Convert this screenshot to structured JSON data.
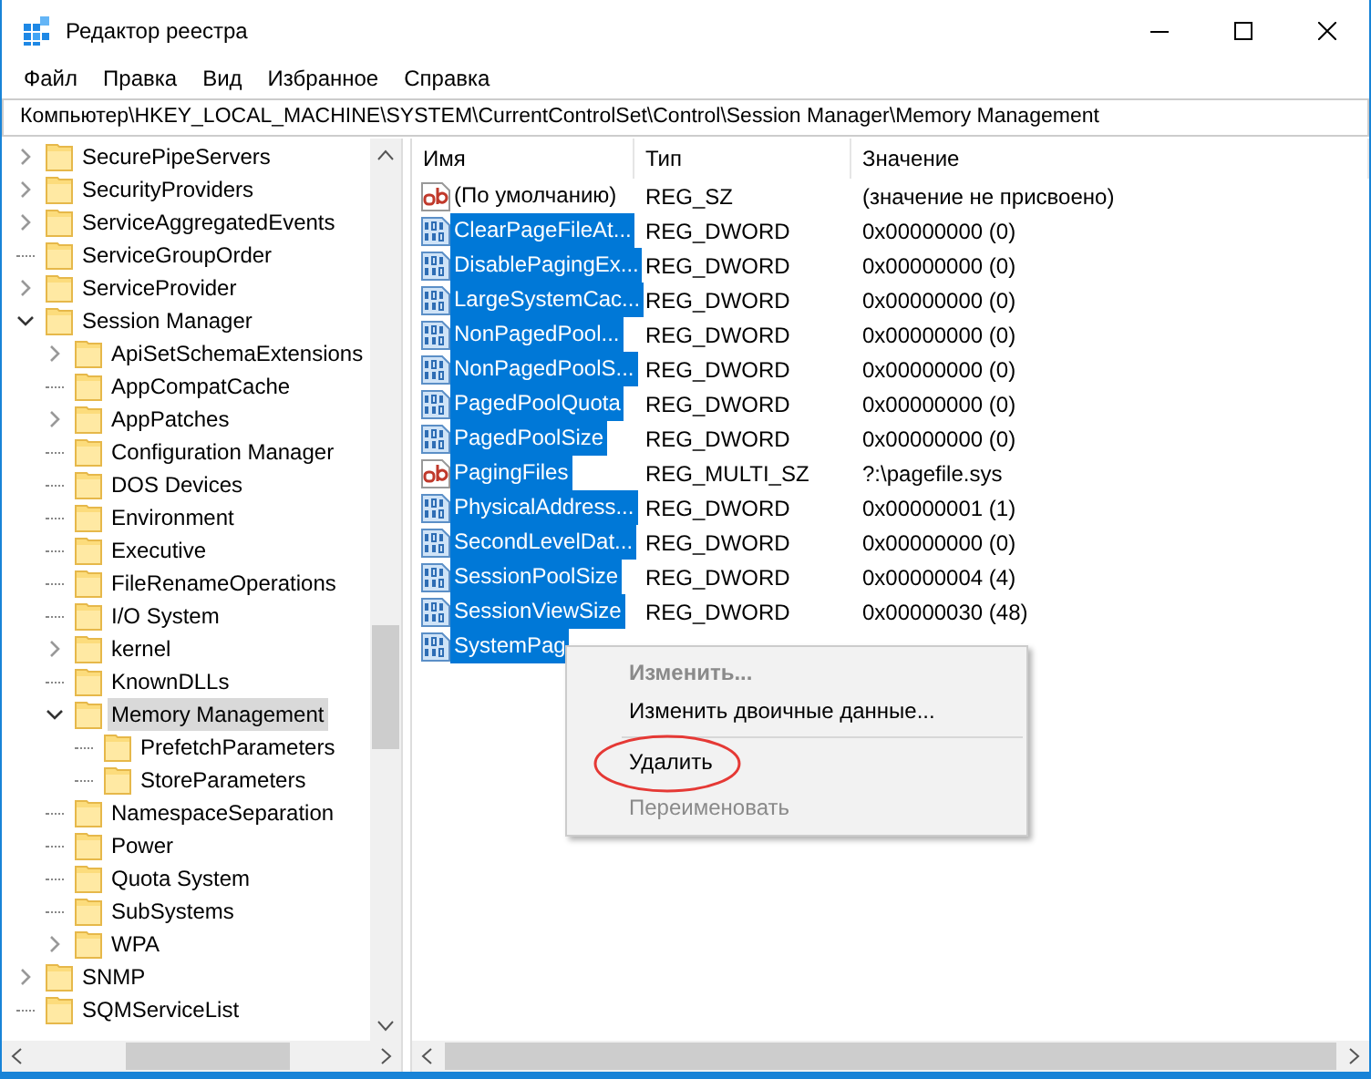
{
  "window": {
    "title": "Редактор реестра"
  },
  "menu": [
    "Файл",
    "Правка",
    "Вид",
    "Избранное",
    "Справка"
  ],
  "address": "Компьютер\\HKEY_LOCAL_MACHINE\\SYSTEM\\CurrentControlSet\\Control\\Session Manager\\Memory Management",
  "tree": [
    {
      "label": "SecurePipeServers",
      "expandable": true,
      "expanded": false,
      "selected": false
    },
    {
      "label": "SecurityProviders",
      "expandable": true,
      "expanded": false,
      "selected": false
    },
    {
      "label": "ServiceAggregatedEvents",
      "expandable": true,
      "expanded": false,
      "selected": false
    },
    {
      "label": "ServiceGroupOrder",
      "expandable": false,
      "selected": false
    },
    {
      "label": "ServiceProvider",
      "expandable": true,
      "expanded": false,
      "selected": false
    },
    {
      "label": "Session Manager",
      "expandable": true,
      "expanded": true,
      "selected": false,
      "children": [
        {
          "label": "ApiSetSchemaExtensions",
          "expandable": true,
          "expanded": false,
          "selected": false
        },
        {
          "label": "AppCompatCache",
          "expandable": false,
          "selected": false
        },
        {
          "label": "AppPatches",
          "expandable": true,
          "expanded": false,
          "selected": false
        },
        {
          "label": "Configuration Manager",
          "expandable": false,
          "selected": false
        },
        {
          "label": "DOS Devices",
          "expandable": false,
          "selected": false
        },
        {
          "label": "Environment",
          "expandable": false,
          "selected": false
        },
        {
          "label": "Executive",
          "expandable": false,
          "selected": false
        },
        {
          "label": "FileRenameOperations",
          "expandable": false,
          "selected": false
        },
        {
          "label": "I/O System",
          "expandable": false,
          "selected": false
        },
        {
          "label": "kernel",
          "expandable": true,
          "expanded": false,
          "selected": false
        },
        {
          "label": "KnownDLLs",
          "expandable": false,
          "selected": false
        },
        {
          "label": "Memory Management",
          "expandable": true,
          "expanded": true,
          "selected": true,
          "children": [
            {
              "label": "PrefetchParameters",
              "expandable": false,
              "selected": false
            },
            {
              "label": "StoreParameters",
              "expandable": false,
              "selected": false
            }
          ]
        },
        {
          "label": "NamespaceSeparation",
          "expandable": false,
          "selected": false
        },
        {
          "label": "Power",
          "expandable": false,
          "selected": false
        },
        {
          "label": "Quota System",
          "expandable": false,
          "selected": false
        },
        {
          "label": "SubSystems",
          "expandable": false,
          "selected": false
        },
        {
          "label": "WPA",
          "expandable": true,
          "expanded": false,
          "selected": false
        }
      ]
    },
    {
      "label": "SNMP",
      "expandable": true,
      "expanded": false,
      "selected": false
    },
    {
      "label": "SQMServiceList",
      "expandable": false,
      "selected": false
    }
  ],
  "table": {
    "columns": [
      "Имя",
      "Тип",
      "Значение"
    ],
    "rows": [
      {
        "kind": "string",
        "name": "(По умолчанию)",
        "type": "REG_SZ",
        "value": "(значение не присвоено)",
        "selected": false
      },
      {
        "kind": "dword",
        "name": "ClearPageFileAt...",
        "type": "REG_DWORD",
        "value": "0x00000000 (0)",
        "selected": true
      },
      {
        "kind": "dword",
        "name": "DisablePagingEx...",
        "type": "REG_DWORD",
        "value": "0x00000000 (0)",
        "selected": true
      },
      {
        "kind": "dword",
        "name": "LargeSystemCac...",
        "type": "REG_DWORD",
        "value": "0x00000000 (0)",
        "selected": true
      },
      {
        "kind": "dword",
        "name": "NonPagedPool...",
        "type": "REG_DWORD",
        "value": "0x00000000 (0)",
        "selected": true
      },
      {
        "kind": "dword",
        "name": "NonPagedPoolS...",
        "type": "REG_DWORD",
        "value": "0x00000000 (0)",
        "selected": true
      },
      {
        "kind": "dword",
        "name": "PagedPoolQuota",
        "type": "REG_DWORD",
        "value": "0x00000000 (0)",
        "selected": true
      },
      {
        "kind": "dword",
        "name": "PagedPoolSize",
        "type": "REG_DWORD",
        "value": "0x00000000 (0)",
        "selected": true
      },
      {
        "kind": "string",
        "name": "PagingFiles",
        "type": "REG_MULTI_SZ",
        "value": "?:\\pagefile.sys",
        "selected": true
      },
      {
        "kind": "dword",
        "name": "PhysicalAddress...",
        "type": "REG_DWORD",
        "value": "0x00000001 (1)",
        "selected": true
      },
      {
        "kind": "dword",
        "name": "SecondLevelDat...",
        "type": "REG_DWORD",
        "value": "0x00000000 (0)",
        "selected": true
      },
      {
        "kind": "dword",
        "name": "SessionPoolSize",
        "type": "REG_DWORD",
        "value": "0x00000004 (4)",
        "selected": true
      },
      {
        "kind": "dword",
        "name": "SessionViewSize",
        "type": "REG_DWORD",
        "value": "0x00000030 (48)",
        "selected": true
      },
      {
        "kind": "dword",
        "name": "SystemPag",
        "selected": true
      }
    ]
  },
  "context_menu": [
    {
      "label": "Изменить...",
      "bold": true,
      "disabled": true
    },
    {
      "label": "Изменить двоичные данные...",
      "bold": false,
      "disabled": false,
      "separator_after": true
    },
    {
      "label": "Удалить",
      "bold": false,
      "disabled": false,
      "highlighted": true
    },
    {
      "label": "Переименовать",
      "bold": false,
      "disabled": true
    }
  ]
}
